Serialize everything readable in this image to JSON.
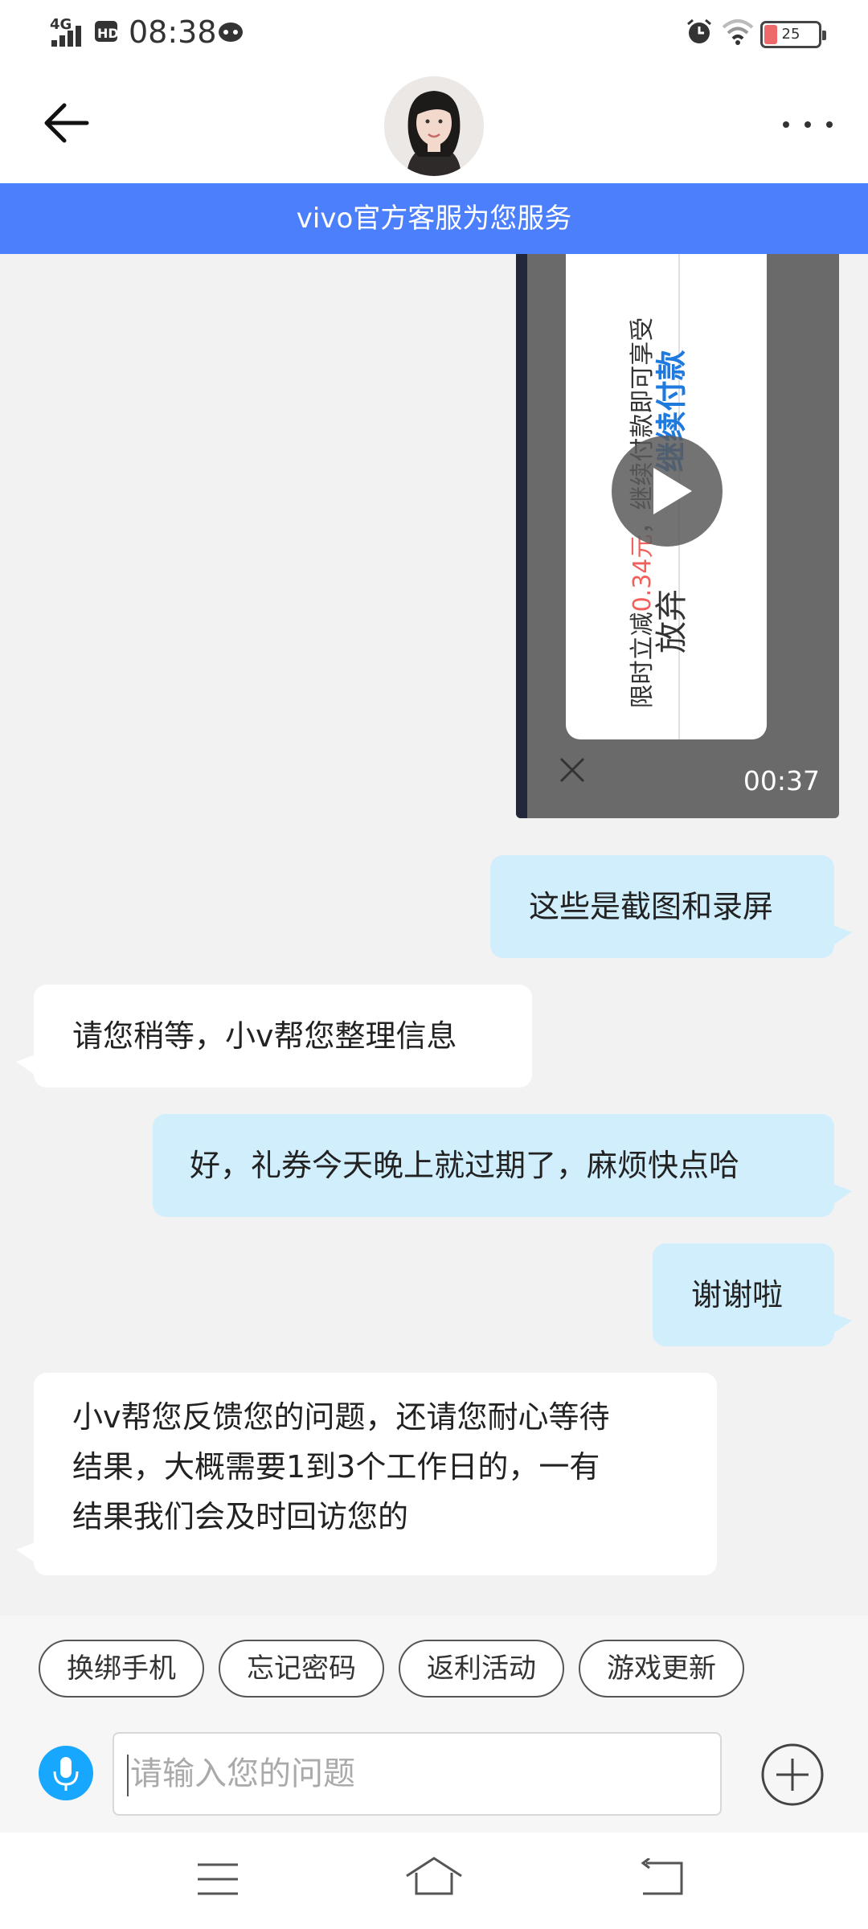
{
  "status_bar": {
    "network": "4G",
    "hd": "HD",
    "time": "08:38",
    "battery_level": "25",
    "battery_color": "#ee6a6a"
  },
  "header": {
    "banner_text": "vivo官方客服为您服务",
    "banner_color": "#4c7ffb"
  },
  "video": {
    "promo_prefix": "限时立减",
    "promo_amount": "0.34元",
    "promo_suffix": "，继续付款即可享受",
    "continue_label": "继续付款",
    "abandon_label": "放弃",
    "duration": "00:37"
  },
  "messages": [
    {
      "side": "right",
      "text": "这些是截图和录屏"
    },
    {
      "side": "left",
      "text": "请您稍等，小v帮您整理信息"
    },
    {
      "side": "right",
      "text": "好，礼券今天晚上就过期了，麻烦快点哈"
    },
    {
      "side": "right",
      "text": "谢谢啦"
    },
    {
      "side": "left",
      "lines": [
        "小v帮您反馈您的问题，还请您耐心等待",
        "结果，大概需要1到3个工作日的，一有",
        "结果我们会及时回访您的"
      ]
    }
  ],
  "quick_replies": [
    "换绑手机",
    "忘记密码",
    "返利活动",
    "游戏更新"
  ],
  "input": {
    "placeholder": "请输入您的问题"
  },
  "colors": {
    "right_bubble": "#d1eefc",
    "left_bubble": "#ffffff",
    "mic": "#18a7ff"
  }
}
